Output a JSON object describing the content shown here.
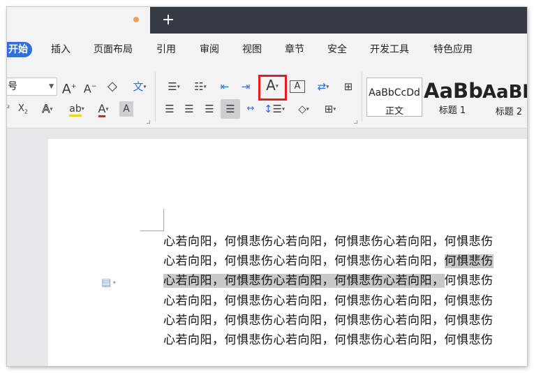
{
  "title_bar": {
    "new_tab_label": "+"
  },
  "menu": {
    "items": [
      {
        "id": "start",
        "label": "开始",
        "active": true
      },
      {
        "id": "insert",
        "label": "插入"
      },
      {
        "id": "layout",
        "label": "页面布局"
      },
      {
        "id": "references",
        "label": "引用"
      },
      {
        "id": "review",
        "label": "审阅"
      },
      {
        "id": "view",
        "label": "视图"
      },
      {
        "id": "chapter",
        "label": "章节"
      },
      {
        "id": "security",
        "label": "安全"
      },
      {
        "id": "devtools",
        "label": "开发工具"
      },
      {
        "id": "special",
        "label": "特色应用"
      }
    ],
    "accent_color": "#2f6fe0"
  },
  "ribbon": {
    "font_size_value": "五号",
    "font_size_visible": "号",
    "icons": {
      "grow_font": "A⁺",
      "shrink_font": "A⁻",
      "clear_format": "◇",
      "phonetic": "文",
      "superscript": "X²",
      "subscript": "X₂",
      "text_effect": "A",
      "highlight": "ab",
      "font_color": "A",
      "char_shading": "A"
    },
    "char_spacing_tooltip_target": "character-spacing-button",
    "highlight_color": "#e02020",
    "styles": [
      {
        "sample": "AaBbCcDd",
        "name": "正文"
      },
      {
        "sample": "AaBb",
        "name": "标题 1"
      },
      {
        "sample": "AaBb",
        "name": "标题 2"
      }
    ]
  },
  "document": {
    "lines": [
      {
        "before": "心若向阳，何惧悲伤心若向阳，何惧悲伤心若向阳，何惧悲伤",
        "selected": "",
        "after": ""
      },
      {
        "before": "心若向阳，何惧悲伤心若向阳，何惧悲伤心若向阳，",
        "selected": "何惧悲伤",
        "after": ""
      },
      {
        "before": "",
        "selected": "心若向阳，何惧悲伤心若向阳，何惧悲伤心若向阳，",
        "after": "何惧悲伤"
      },
      {
        "before": "心若向阳，何惧悲伤心若向阳，何惧悲伤心若向阳，何惧悲伤",
        "selected": "",
        "after": ""
      },
      {
        "before": "心若向阳，何惧悲伤心若向阳，何惧悲伤心若向阳，何惧悲伤",
        "selected": "",
        "after": ""
      },
      {
        "before": "心若向阳，何惧悲伤心若向阳，何惧悲伤心若向阳，何惧悲伤",
        "selected": "",
        "after": ""
      }
    ],
    "selection_color": "#c9c9c9"
  }
}
